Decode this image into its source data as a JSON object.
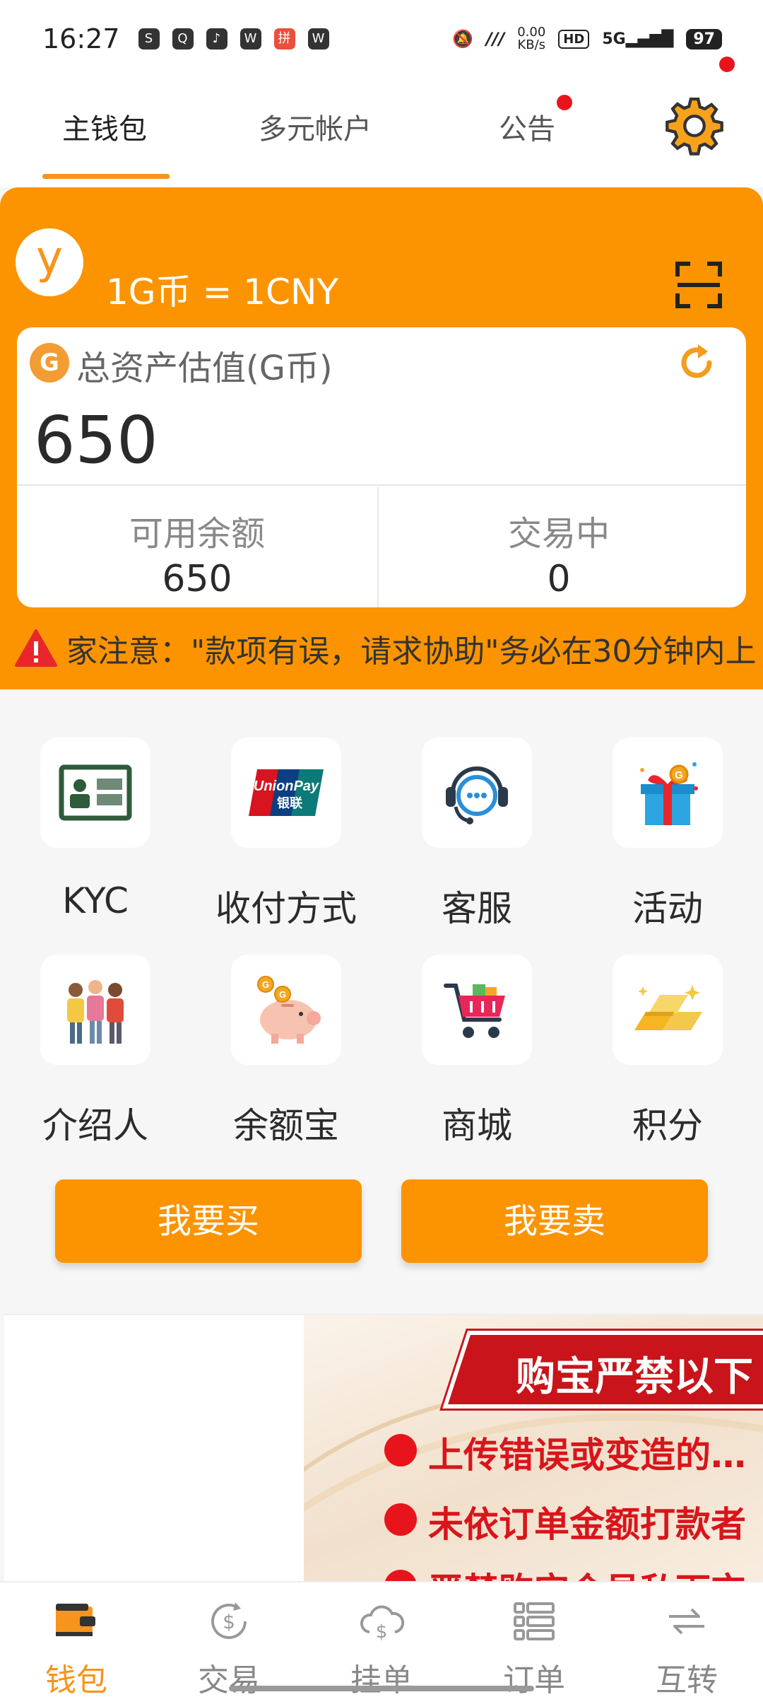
{
  "status_bar": {
    "time": "16:27",
    "speed_value": "0.00",
    "speed_unit": "KB/s",
    "hd": "HD",
    "network": "5G",
    "battery": "97"
  },
  "tabs": [
    {
      "label": "主钱包",
      "active": true
    },
    {
      "label": "多元帐户",
      "active": false
    },
    {
      "label": "公告",
      "active": false,
      "has_dot": true
    }
  ],
  "wallet": {
    "avatar_letter": "y",
    "rate": "1G币 = 1CNY",
    "coin_symbol": "G",
    "total_label": "总资产估值(G币)",
    "total_value": "650",
    "available_label": "可用余额",
    "available_value": "650",
    "trading_label": "交易中",
    "trading_value": "0",
    "notice": "家注意：\"款项有误，请求协助\"务必在30分钟内上"
  },
  "grid": [
    {
      "label": "KYC",
      "icon": "id-card-icon"
    },
    {
      "label": "收付方式",
      "icon": "unionpay-icon"
    },
    {
      "label": "客服",
      "icon": "customer-service-icon"
    },
    {
      "label": "活动",
      "icon": "gift-icon"
    },
    {
      "label": "介绍人",
      "icon": "people-icon"
    },
    {
      "label": "余额宝",
      "icon": "piggy-bank-icon"
    },
    {
      "label": "商城",
      "icon": "shopping-cart-icon"
    },
    {
      "label": "积分",
      "icon": "gold-bars-icon"
    }
  ],
  "actions": {
    "buy": "我要买",
    "sell": "我要卖"
  },
  "banner": {
    "title": "购宝严禁以下",
    "lines": [
      "上传错误或变造的…",
      "未依订单金额打款者",
      "严禁购宝会员私下交"
    ]
  },
  "bottom_nav": [
    {
      "label": "钱包",
      "icon": "wallet-icon",
      "active": true
    },
    {
      "label": "交易",
      "icon": "dollar-cycle-icon",
      "active": false
    },
    {
      "label": "挂单",
      "icon": "cloud-dollar-icon",
      "active": false
    },
    {
      "label": "订单",
      "icon": "list-icon",
      "active": false
    },
    {
      "label": "互转",
      "icon": "transfer-icon",
      "active": false
    }
  ],
  "colors": {
    "accent": "#fb9400",
    "badge": "#e8141c"
  }
}
